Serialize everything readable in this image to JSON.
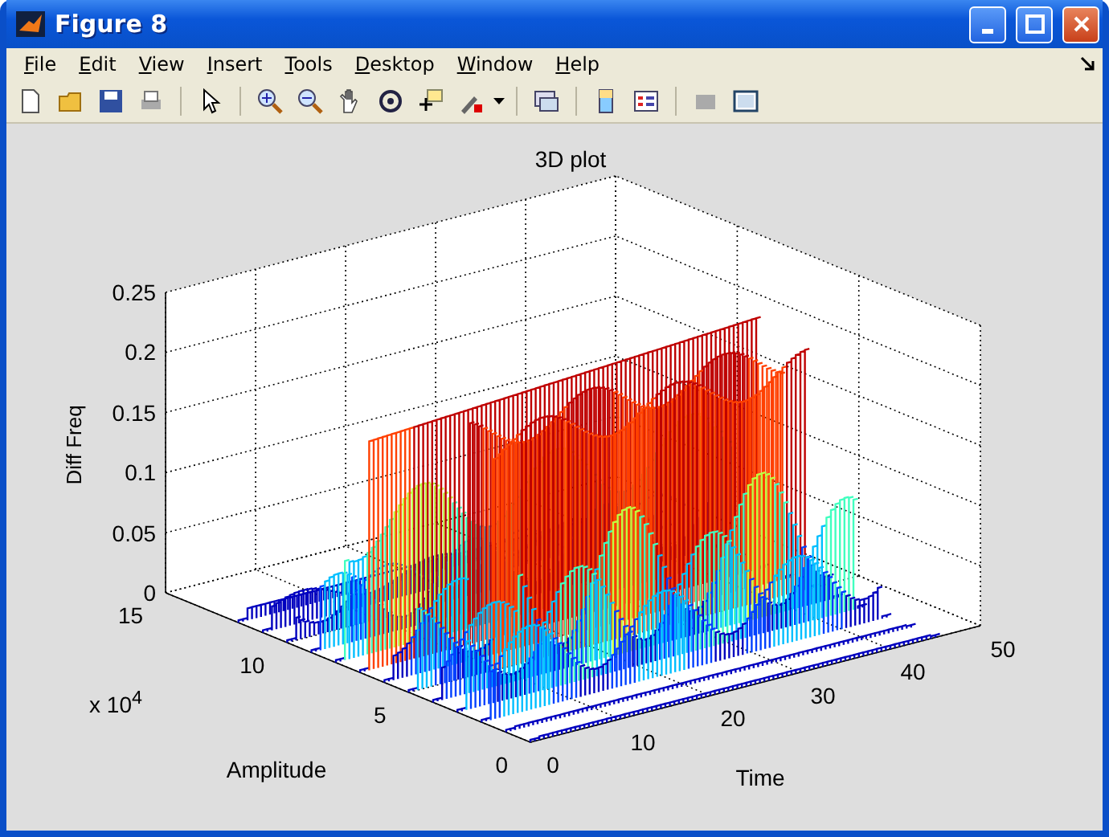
{
  "window": {
    "title": "Figure 8"
  },
  "menu": [
    "File",
    "Edit",
    "View",
    "Insert",
    "Tools",
    "Desktop",
    "Window",
    "Help"
  ],
  "plot": {
    "title": "3D plot",
    "zlabel": "Diff Freq",
    "ylabel": "Amplitude",
    "xlabel": "Time",
    "y_exponent": "x 10$^{4}$",
    "zticks": [
      "0.25",
      "0.2",
      "0.15",
      "0.1",
      "0.05",
      "0"
    ],
    "yticks": [
      "0",
      "5",
      "10",
      "15"
    ],
    "xticks": [
      "0",
      "10",
      "20",
      "30",
      "40",
      "50"
    ]
  }
}
